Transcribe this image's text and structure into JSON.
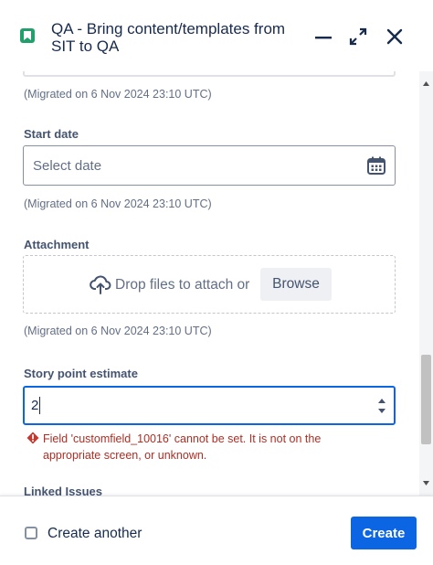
{
  "header": {
    "title": "QA - Bring content/templates from SIT to QA",
    "issue_type_icon": "story-icon",
    "minimize_icon": "minimize-icon",
    "expand_icon": "expand-icon",
    "close_icon": "close-icon"
  },
  "fields": {
    "prev_migrated": "(Migrated on 6 Nov 2024 23:10 UTC)",
    "start_date": {
      "label": "Start date",
      "placeholder": "Select date",
      "icon": "calendar-icon",
      "migrated": "(Migrated on 6 Nov 2024 23:10 UTC)"
    },
    "attachment": {
      "label": "Attachment",
      "drop_text": "Drop files to attach or",
      "browse_label": "Browse",
      "icon": "upload-cloud-icon",
      "migrated": "(Migrated on 6 Nov 2024 23:10 UTC)"
    },
    "story_points": {
      "label": "Story point estimate",
      "value": "2",
      "error": "Field 'customfield_10016' cannot be set. It is not on the appropriate screen, or unknown.",
      "error_icon": "error-icon"
    },
    "linked_issues": {
      "label": "Linked Issues"
    }
  },
  "footer": {
    "create_another_label": "Create another",
    "create_another_checked": false,
    "create_label": "Create"
  },
  "colors": {
    "primary": "#0c66e4",
    "error": "#ae2e24",
    "story": "#22a06b"
  }
}
